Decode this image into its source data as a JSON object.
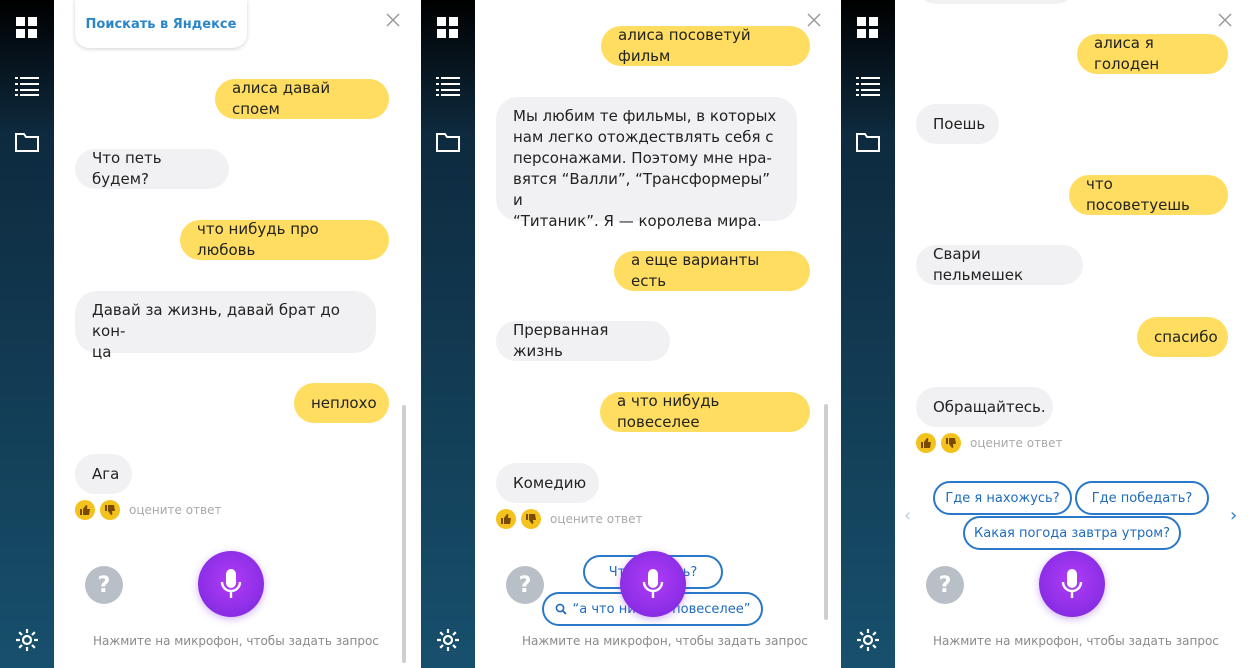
{
  "panel1": {
    "search_card": "Поискать в Яндексе",
    "messages": [
      "алиса давай споем",
      "Что петь будем?",
      "что нибудь про любовь",
      "Давай за жизнь, давай брат до кон-",
      "ца",
      "неплохо",
      "Ага"
    ],
    "rate_label": "оцените ответ",
    "hint": "Нажмите на микрофон, чтобы задать запрос"
  },
  "panel2": {
    "messages": [
      "алиса посоветуй фильм",
      "Мы любим те фильмы, в которых",
      "нам легко отождествлять себя с",
      "персонажами. Поэтому мне нра-",
      "вятся “Валли”, “Трансформеры” и",
      "“Титаник”. Я — королева мира.",
      "а еще варианты есть",
      "Прерванная жизнь",
      "а что нибудь повеселее",
      "Комедию"
    ],
    "rate_label": "оцените ответ",
    "suggestions": [
      "Что умеешь?",
      "“а что нибудь повеселее”"
    ],
    "hint": "Нажмите на микрофон, чтобы задать запрос"
  },
  "panel3": {
    "messages": [
      "алиса я голоден",
      "Поешь",
      "что посоветуешь",
      "Свари пельмешек",
      "спасибо",
      "Обращайтесь."
    ],
    "rate_label": "оцените ответ",
    "suggestions": [
      "Где я нахожусь?",
      "Где победать?",
      "Какая погода завтра утром?"
    ],
    "hint": "Нажмите на микрофон, чтобы задать запрос"
  },
  "colors": {
    "user_bubble": "#ffdd60",
    "bot_bubble": "#f1f1f3",
    "mic": "#9b34ef",
    "suggestion_border": "#2a78c8"
  },
  "icons": [
    "apps-grid-icon",
    "list-icon",
    "folder-icon",
    "gear-icon",
    "close-icon",
    "thumb-up-icon",
    "thumb-down-icon",
    "help-icon",
    "microphone-icon",
    "chevron-left-icon",
    "chevron-right-icon",
    "search-icon"
  ]
}
